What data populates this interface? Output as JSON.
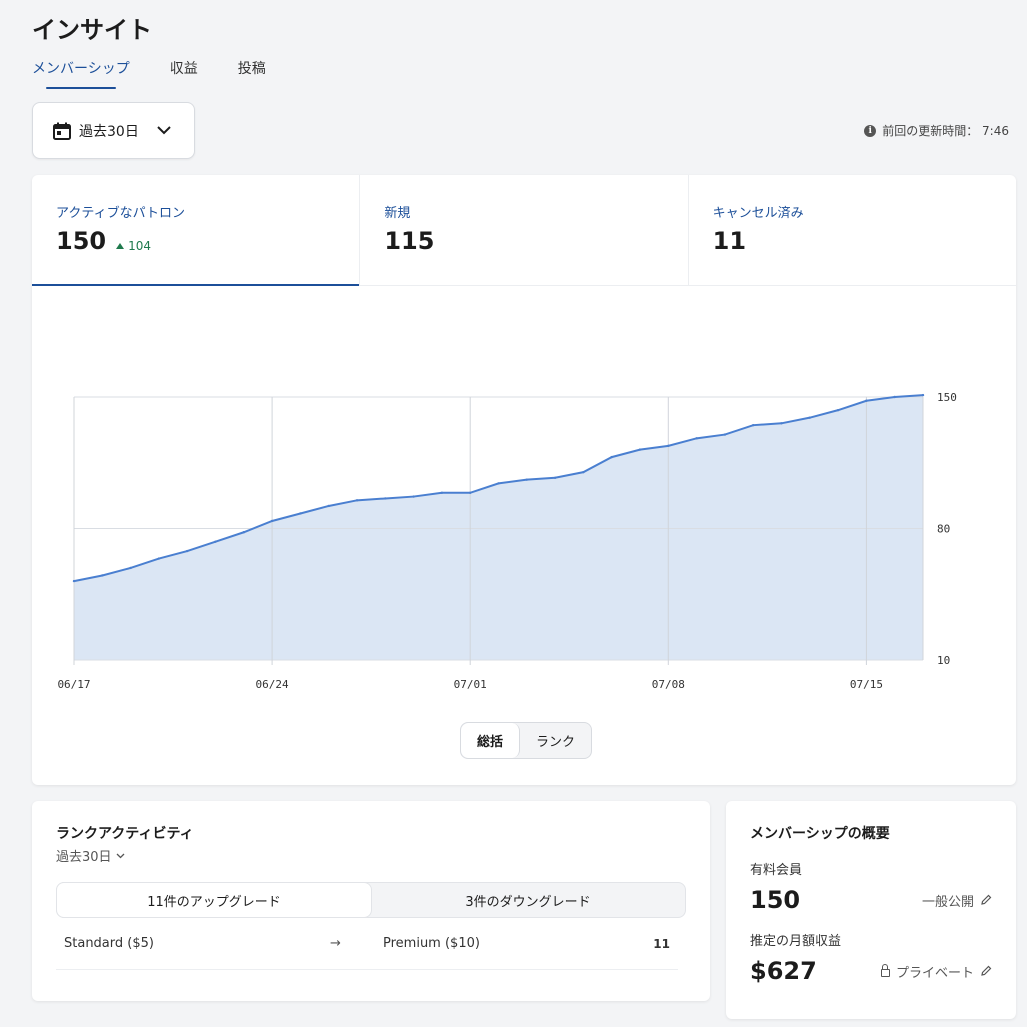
{
  "page": {
    "title": "インサイト"
  },
  "tabs": [
    {
      "label": "メンバーシップ",
      "active": true
    },
    {
      "label": "収益",
      "active": false
    },
    {
      "label": "投稿",
      "active": false
    }
  ],
  "range": {
    "label": "過去30日",
    "icon": "calendar-icon"
  },
  "update": {
    "text": "前回の更新時間： 7:46",
    "icon": "info-icon"
  },
  "metrics": [
    {
      "label": "アクティブなパトロン",
      "value": "150",
      "delta": "104"
    },
    {
      "label": "新規",
      "value": "115"
    },
    {
      "label": "キャンセル済み",
      "value": "11"
    }
  ],
  "chart_data": {
    "type": "area",
    "x": [
      "06/17",
      "06/18",
      "06/19",
      "06/20",
      "06/21",
      "06/22",
      "06/23",
      "06/24",
      "06/25",
      "06/26",
      "06/27",
      "06/28",
      "06/29",
      "06/30",
      "07/01",
      "07/02",
      "07/03",
      "07/04",
      "07/05",
      "07/06",
      "07/07",
      "07/08",
      "07/09",
      "07/10",
      "07/11",
      "07/12",
      "07/13",
      "07/14",
      "07/15",
      "07/16",
      "07/17"
    ],
    "series": [
      {
        "values": [
          52,
          55,
          59,
          64,
          68,
          73,
          78,
          84,
          88,
          92,
          95,
          96,
          97,
          99,
          99,
          104,
          106,
          107,
          110,
          118,
          122,
          124,
          128,
          130,
          135,
          136,
          139,
          143,
          148,
          150,
          151
        ]
      }
    ],
    "x_ticks": [
      "06/17",
      "06/24",
      "07/01",
      "07/08",
      "07/15"
    ],
    "y_ticks": [
      "150",
      "80",
      "10"
    ],
    "ylim": [
      10,
      150
    ],
    "grid": true,
    "color": "#4a7fd0",
    "fill": "#dbe6f4"
  },
  "chart_toggle": {
    "summary": "総括",
    "rank": "ランク"
  },
  "rank_activity": {
    "title": "ランクアクティビティ",
    "period": "過去30日",
    "upgrades": "11件のアップグレード",
    "downgrades": "3件のダウングレード",
    "rows": [
      {
        "from": "Standard ($5)",
        "arrow": "→",
        "to": "Premium ($10)",
        "count": "11"
      }
    ]
  },
  "membership": {
    "title": "メンバーシップの概要",
    "paid_label": "有料会員",
    "paid_value": "150",
    "paid_visibility": "一般公開",
    "revenue_label": "推定の月額収益",
    "revenue_value": "$627",
    "revenue_visibility": "プライベート"
  }
}
